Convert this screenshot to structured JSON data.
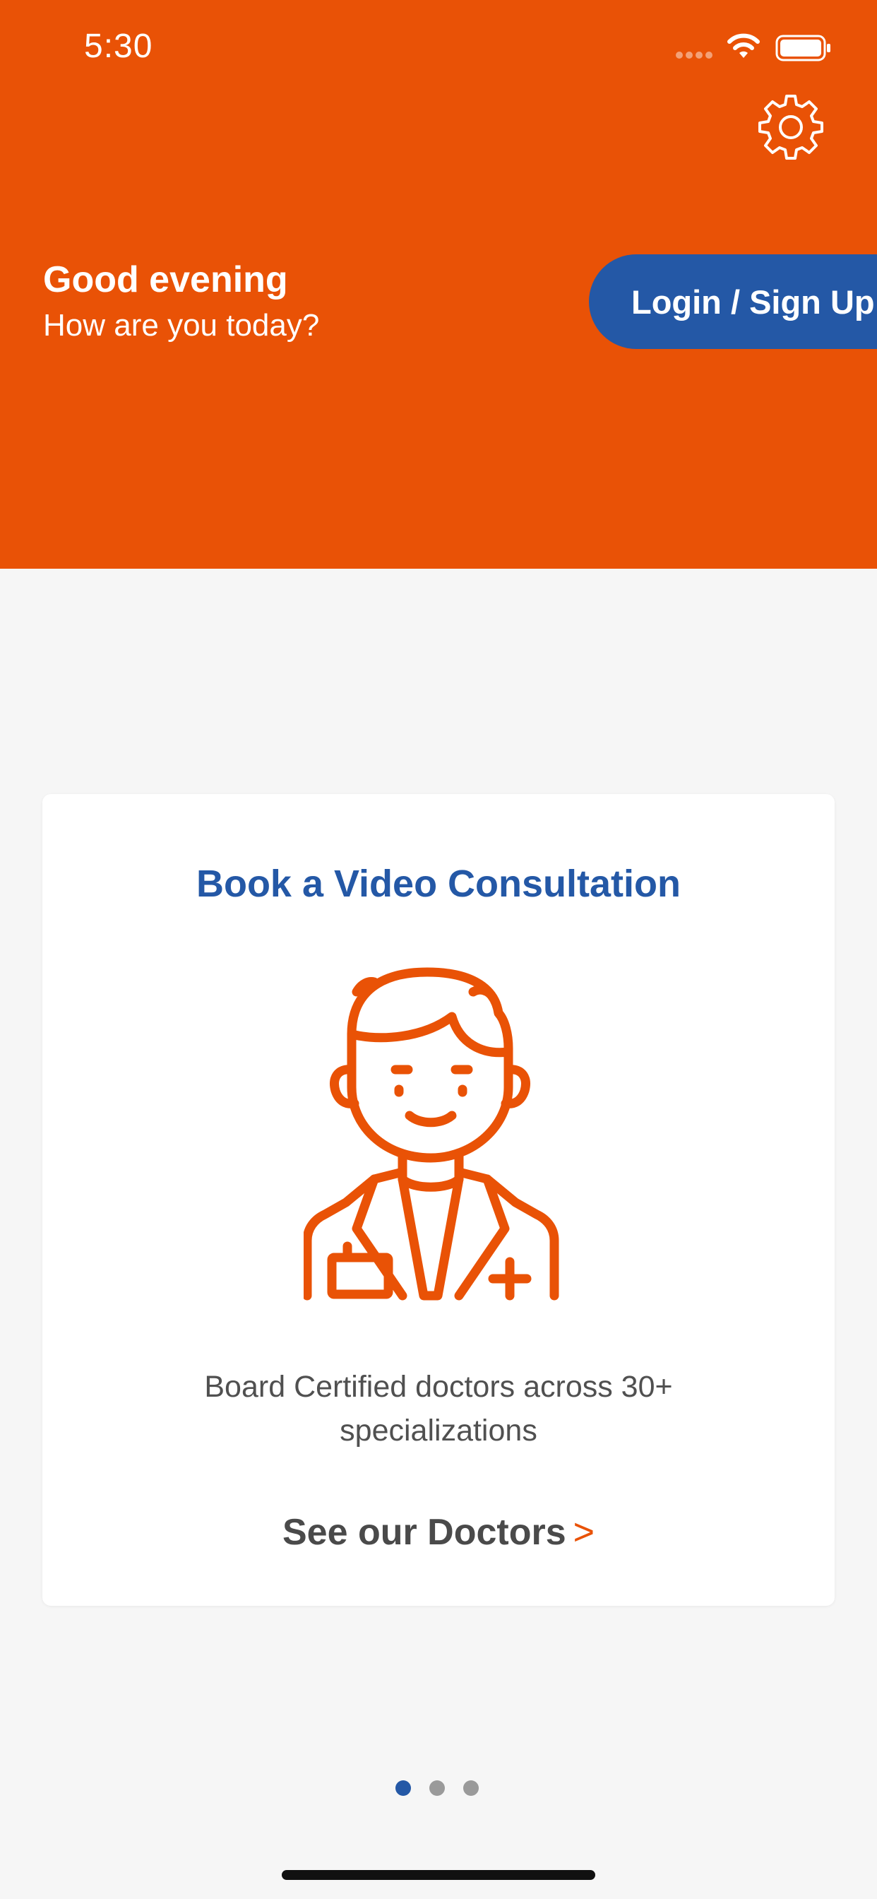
{
  "status_bar": {
    "time": "5:30",
    "icons": [
      "signal-icon",
      "wifi-icon",
      "battery-icon"
    ]
  },
  "header": {
    "background_color": "#e95206",
    "settings_icon": "gear-icon",
    "greeting": "Good evening",
    "subgreeting": "How are you today?",
    "login_label": "Login / Sign Up",
    "login_color": "#2458a6"
  },
  "card": {
    "title": "Book a Video Consultation",
    "illustration": "doctor-icon",
    "description": "Board Certified doctors across 30+ specializations",
    "link_label": "See our Doctors",
    "link_arrow": ">"
  },
  "pagination": {
    "total": 3,
    "active_index": 0,
    "active_color": "#2458a6",
    "inactive_color": "#9a9a9a"
  }
}
